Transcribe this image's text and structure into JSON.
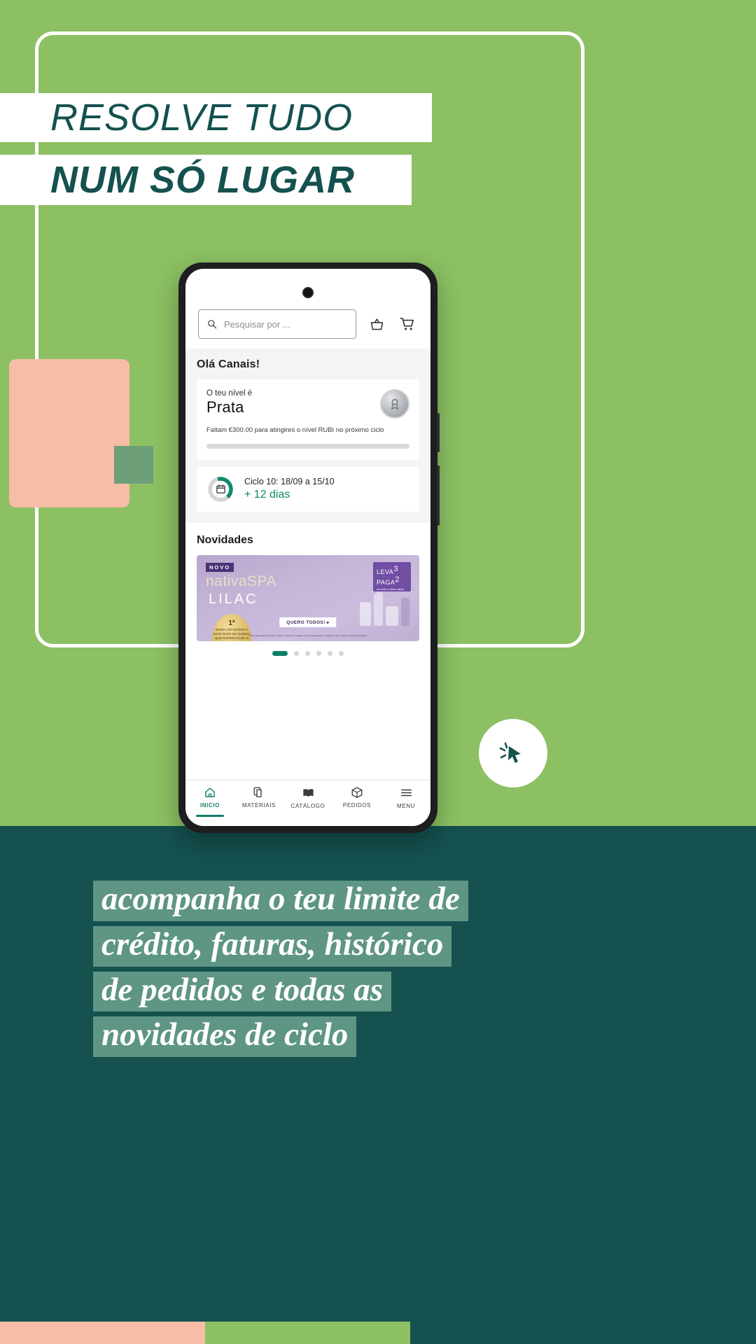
{
  "poster": {
    "headline_line1": "RESOLVE TUDO",
    "headline_line2": "NUM SÓ LUGAR",
    "caption_lines": [
      "acompanha o teu limite de",
      "crédito, faturas, histórico",
      "de pedidos e todas as",
      "novidades de ciclo"
    ],
    "colors": {
      "green": "#8cc063",
      "teal": "#14514f",
      "peach": "#f7bda6",
      "caption_highlight": "#5e9584",
      "accent_teal": "#0e7d6a"
    }
  },
  "phone": {
    "search": {
      "placeholder": "Pesquisar por ...",
      "icon": "search-icon"
    },
    "header_actions": [
      {
        "icon": "basket-icon",
        "name": "basket-button"
      },
      {
        "icon": "cart-icon",
        "name": "cart-button"
      }
    ],
    "greeting": "Olá Canais!",
    "level_card": {
      "label": "O teu nível é",
      "level": "Prata",
      "message": "Faltam €300.00 para atingires o nível RUBI no próximo ciclo",
      "badge_icon": "medal-icon",
      "progress_percent": 0
    },
    "cycle_card": {
      "icon": "calendar-icon",
      "title": "Ciclo 10: 18/09 a 15/10",
      "remaining": "+ 12 dias",
      "donut_percent": 42
    },
    "news": {
      "title": "Novidades",
      "banner": {
        "tag": "NOVO",
        "brand": "nativaSPA",
        "product_line": "LILAC",
        "seal_rank": "1ª",
        "seal_text": "MARCA DO MUNDO A USAR ÓLEO DE QUINOA, QUE POTENCIALIZA O COLÁGENO NATURAL DA PELE*",
        "promo_line1": "LEVA",
        "promo_num1": "3",
        "promo_line2": "PAGA",
        "promo_num2": "2",
        "promo_small": "em toda a linha nativa SPA*",
        "cta": "QUERO TODOS! ▸",
        "legal": "*Oferta válida enquanto durarem os stocks. Consulta as condições e produtos participantes no catálogo em vigor. Imagens meramente ilustrativas."
      },
      "pager": {
        "total": 6,
        "active_index": 0
      }
    },
    "nav": [
      {
        "label": "INICIO",
        "icon": "home-icon",
        "active": true
      },
      {
        "label": "MATERIAIS",
        "icon": "documents-icon",
        "active": false
      },
      {
        "label": "CATÁLOGO",
        "icon": "book-icon",
        "active": false
      },
      {
        "label": "PEDIDOS",
        "icon": "box-icon",
        "active": false
      },
      {
        "label": "MENU",
        "icon": "hamburger-icon",
        "active": false
      }
    ]
  }
}
